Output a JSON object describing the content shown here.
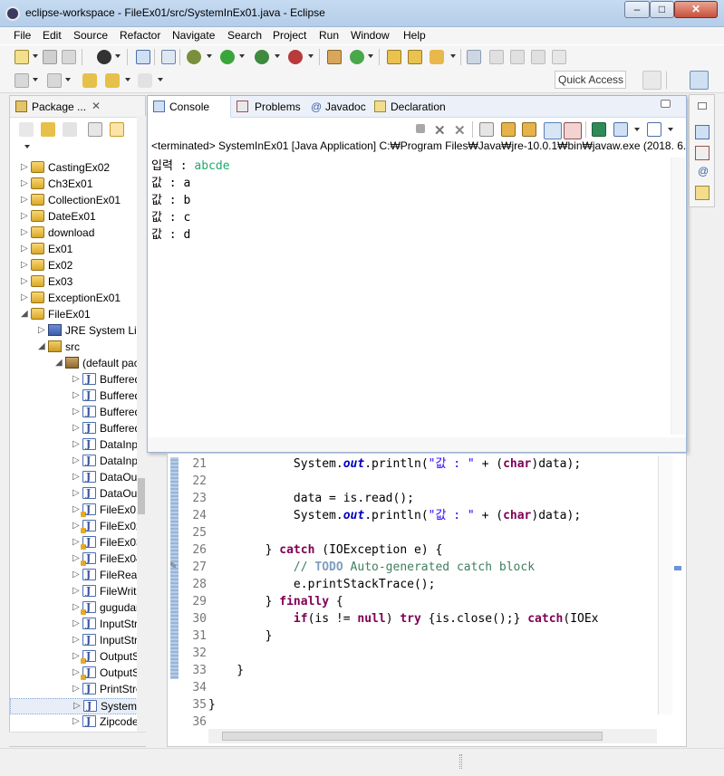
{
  "window": {
    "title": "eclipse-workspace - FileEx01/src/SystemInEx01.java - Eclipse",
    "controls": {
      "minimize": "–",
      "maximize": "□",
      "close": "✕"
    }
  },
  "menu": [
    "File",
    "Edit",
    "Source",
    "Refactor",
    "Navigate",
    "Search",
    "Project",
    "Run",
    "Window",
    "Help"
  ],
  "quick_access": "Quick Access",
  "package_explorer": {
    "tab_label": "Package ...",
    "tab_close": "✕",
    "items": [
      {
        "label": "CastingEx02",
        "type": "project",
        "expanded": false
      },
      {
        "label": "Ch3Ex01",
        "type": "project",
        "expanded": false
      },
      {
        "label": "CollectionEx01",
        "type": "project",
        "expanded": false
      },
      {
        "label": "DateEx01",
        "type": "project",
        "expanded": false
      },
      {
        "label": "download",
        "type": "project",
        "expanded": false
      },
      {
        "label": "Ex01",
        "type": "project",
        "expanded": false
      },
      {
        "label": "Ex02",
        "type": "project",
        "expanded": false
      },
      {
        "label": "Ex03",
        "type": "project",
        "expanded": false
      },
      {
        "label": "ExceptionEx01",
        "type": "project",
        "expanded": false
      },
      {
        "label": "FileEx01",
        "type": "project",
        "expanded": true
      },
      {
        "label": "JRE System Libr",
        "type": "library",
        "expanded": false
      },
      {
        "label": "src",
        "type": "source",
        "expanded": true
      },
      {
        "label": "(default pac",
        "type": "package",
        "expanded": true
      },
      {
        "label": "Buffered",
        "type": "java"
      },
      {
        "label": "Buffered",
        "type": "java"
      },
      {
        "label": "Buffered",
        "type": "java"
      },
      {
        "label": "Buffered",
        "type": "java"
      },
      {
        "label": "DataInpu",
        "type": "java"
      },
      {
        "label": "DataInpu",
        "type": "java"
      },
      {
        "label": "DataOutp",
        "type": "java"
      },
      {
        "label": "DataOutp",
        "type": "java"
      },
      {
        "label": "FileEx01.",
        "type": "java-warn"
      },
      {
        "label": "FileEx02.",
        "type": "java-warn"
      },
      {
        "label": "FileEx03.",
        "type": "java-warn"
      },
      {
        "label": "FileEx04.",
        "type": "java-warn"
      },
      {
        "label": "FileReade",
        "type": "java"
      },
      {
        "label": "FileWriter",
        "type": "java"
      },
      {
        "label": "gugudan",
        "type": "java-warn"
      },
      {
        "label": "InputStre",
        "type": "java"
      },
      {
        "label": "InputStre",
        "type": "java"
      },
      {
        "label": "OutputSt",
        "type": "java-warn"
      },
      {
        "label": "OutputSt",
        "type": "java-warn"
      },
      {
        "label": "PrintStrea",
        "type": "java"
      },
      {
        "label": "SystemIn",
        "type": "java",
        "selected": true
      },
      {
        "label": "ZipcodeS",
        "type": "java"
      }
    ]
  },
  "console_view": {
    "tabs": [
      {
        "label": "Console",
        "active": true
      },
      {
        "label": "Problems",
        "active": false
      },
      {
        "label": "Javadoc",
        "active": false
      },
      {
        "label": "Declaration",
        "active": false
      }
    ],
    "header": "<terminated> SystemInEx01 [Java Application] C:₩Program Files₩Java₩jre-10.0.1₩bin₩javaw.exe (2018. 6. 2",
    "output": [
      {
        "prefix": "입력 : ",
        "input": "abcde"
      },
      {
        "prefix": "값 : a",
        "input": ""
      },
      {
        "prefix": "값 : b",
        "input": ""
      },
      {
        "prefix": "값 : c",
        "input": ""
      },
      {
        "prefix": "값 : d",
        "input": ""
      }
    ]
  },
  "editor": {
    "line_numbers": [
      "21",
      "22",
      "23",
      "24",
      "25",
      "26",
      "27",
      "28",
      "29",
      "30",
      "31",
      "32",
      "33",
      "34",
      "35",
      "36"
    ],
    "code": {
      "l21": {
        "indent": "            ",
        "a": "System.",
        "b": "out",
        "c": ".println(",
        "d": "\"값 : \"",
        "e": " + (",
        "f": "char",
        "g": ")data);"
      },
      "l23": "            data = is.read();",
      "l24": {
        "indent": "            ",
        "a": "System.",
        "b": "out",
        "c": ".println(",
        "d": "\"값 : \"",
        "e": " + (",
        "f": "char",
        "g": ")data);"
      },
      "l26": {
        "a": "        } ",
        "b": "catch",
        "c": " (IOException e) {"
      },
      "l27": {
        "indent": "            ",
        "a": "// ",
        "b": "TODO",
        "c": " Auto-generated catch block"
      },
      "l28": "            e.printStackTrace();",
      "l29": {
        "a": "        } ",
        "b": "finally",
        "c": " {"
      },
      "l30": {
        "indent": "            ",
        "a": "if",
        "b": "(is != ",
        "c": "null",
        "d": ") ",
        "e": "try",
        "f": " {is.close();} ",
        "g": "catch",
        "h": "(IOEx"
      },
      "l31": "        }",
      "l33": "    }",
      "l35": "}"
    }
  }
}
